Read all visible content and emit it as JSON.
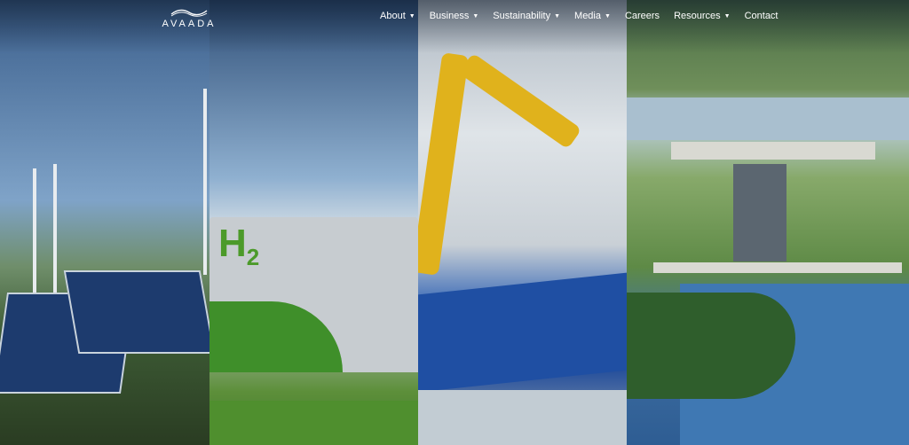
{
  "brand": {
    "name": "AVAADA"
  },
  "nav": [
    {
      "label": "About",
      "has_dropdown": true
    },
    {
      "label": "Business",
      "has_dropdown": true
    },
    {
      "label": "Sustainability",
      "has_dropdown": true
    },
    {
      "label": "Media",
      "has_dropdown": true
    },
    {
      "label": "Careers",
      "has_dropdown": false
    },
    {
      "label": "Resources",
      "has_dropdown": true
    },
    {
      "label": "Contact",
      "has_dropdown": false
    }
  ],
  "hero": {
    "panel2_mark": "H",
    "panel2_mark_sub": "2"
  },
  "colors": {
    "nav_text": "#ffffff",
    "hydrogen_green": "#4c9a2a"
  }
}
